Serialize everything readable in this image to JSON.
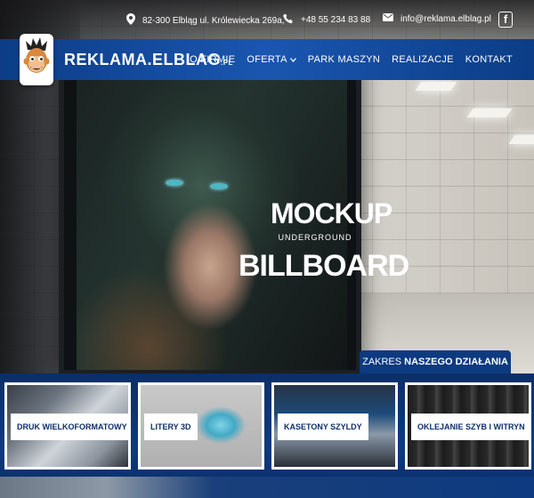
{
  "topbar": {
    "address": "82-300 Elbląg ul. Królewiecka 269a,",
    "phone": "+48 55 234 83 88",
    "email": "info@reklama.elblag.pl",
    "facebook_glyph": "f"
  },
  "header": {
    "logo_main": "REKLAMA.ELBLAG",
    "logo_suffix": ".PL",
    "nav": [
      {
        "label": "O FIRMIE"
      },
      {
        "label": "OFERTA"
      },
      {
        "label": "PARK MASZYN"
      },
      {
        "label": "REALIZACJE"
      },
      {
        "label": "KONTAKT"
      }
    ]
  },
  "hero": {
    "billboard_line1": "MOCKUP",
    "billboard_line2": "UNDERGROUND",
    "billboard_line3": "BILLBOARD"
  },
  "services": {
    "tab_prefix": "ZAKRES",
    "tab_bold": "NASZEGO DZIAŁANIA",
    "cards": [
      {
        "label": "DRUK WIELKOFORMATOWY"
      },
      {
        "label": "LITERY 3D"
      },
      {
        "label": "KASETONY SZYLDY"
      },
      {
        "label": "OKLEJANIE SZYB I WITRYN"
      }
    ]
  },
  "icons": {
    "address": "map-pin-icon",
    "phone": "phone-icon",
    "email": "envelope-icon",
    "facebook": "facebook-icon"
  },
  "colors": {
    "brand_blue": "#0d3a80",
    "header_blue": "#1a56b0",
    "label_text": "#0e2f6a",
    "billboard_eye": "#4fb6c3"
  }
}
